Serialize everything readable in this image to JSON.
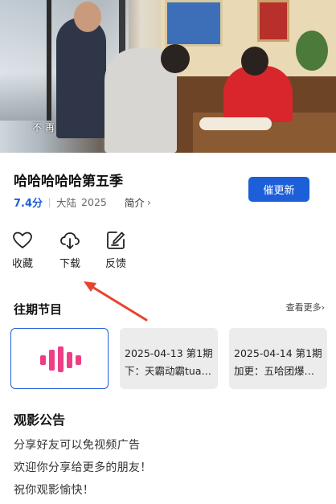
{
  "video": {
    "caption": "不 再"
  },
  "show": {
    "title": "哈哈哈哈哈第五季",
    "score": "7.4分",
    "region": "大陆",
    "year": "2025",
    "intro_label": "简介",
    "update_button": "催更新"
  },
  "actions": [
    {
      "label": "收藏",
      "icon": "heart-icon"
    },
    {
      "label": "下载",
      "icon": "download-cloud-icon"
    },
    {
      "label": "反馈",
      "icon": "feedback-edit-icon"
    }
  ],
  "episodes_section": {
    "title": "往期节目",
    "more_label": "查看更多",
    "items": [
      {
        "line1": "",
        "line2": "",
        "icon": "playing-equalizer-icon",
        "active": true
      },
      {
        "line1": "2025-04-13 第1期",
        "line2": "下：天霸动霸tua…",
        "active": false
      },
      {
        "line1": "2025-04-14 第1期",
        "line2": "加更：五哈团爆…",
        "active": false
      }
    ]
  },
  "announcement": {
    "title": "观影公告",
    "lines": [
      "分享好友可以免视频广告",
      "欢迎你分享给更多的朋友！",
      "祝你观影愉快！"
    ]
  },
  "colors": {
    "accent": "#1c5fd8",
    "equalizer": "#ee3f86",
    "annotation_arrow": "#e8432f"
  }
}
